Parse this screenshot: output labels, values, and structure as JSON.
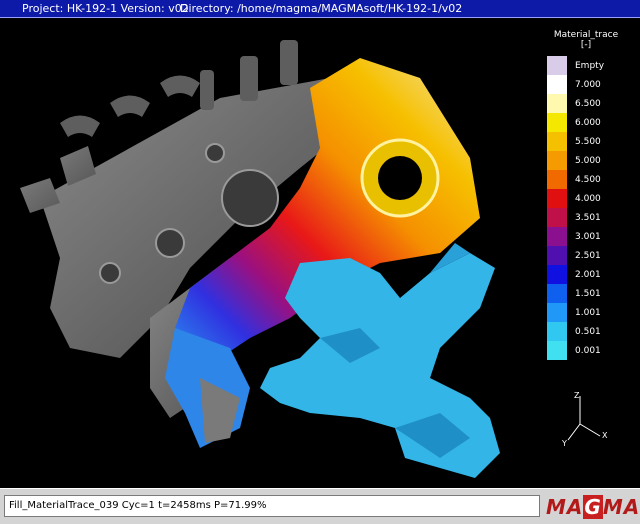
{
  "titlebar": {
    "project": "Project: HK-192-1 Version: v02",
    "directory": "Directory: /home/magma/MAGMAsoft/HK-192-1/v02"
  },
  "legend": {
    "title": "Material_trace",
    "unit": "[-]",
    "entries": [
      {
        "label": "Empty",
        "color": "#d8cce8"
      },
      {
        "label": "7.000",
        "color": "#ffffff"
      },
      {
        "label": "6.500",
        "color": "#fff9b0"
      },
      {
        "label": "6.000",
        "color": "#f5e800"
      },
      {
        "label": "5.500",
        "color": "#f5c000"
      },
      {
        "label": "5.000",
        "color": "#f59a00"
      },
      {
        "label": "4.500",
        "color": "#f06a00"
      },
      {
        "label": "4.000",
        "color": "#e01010"
      },
      {
        "label": "3.501",
        "color": "#c0104a"
      },
      {
        "label": "3.001",
        "color": "#8a1090"
      },
      {
        "label": "2.501",
        "color": "#5010b0"
      },
      {
        "label": "2.001",
        "color": "#1010e0"
      },
      {
        "label": "1.501",
        "color": "#1060f0"
      },
      {
        "label": "1.001",
        "color": "#2098f8"
      },
      {
        "label": "0.501",
        "color": "#30c8f0"
      },
      {
        "label": "0.001",
        "color": "#40e0f0"
      }
    ]
  },
  "axes": {
    "x": "X",
    "y": "Y",
    "z": "Z"
  },
  "status": {
    "text": "Fill_MaterialTrace_039 Cyc=1 t=2458ms P=71.99%"
  },
  "logo": {
    "text_a": "MA",
    "text_g": "G",
    "text_b": "MA"
  },
  "colors": {
    "title_bar": "#0d1aa8",
    "casting_gray": "#6e6e6e",
    "runner_cyan": "#33b5e8"
  }
}
